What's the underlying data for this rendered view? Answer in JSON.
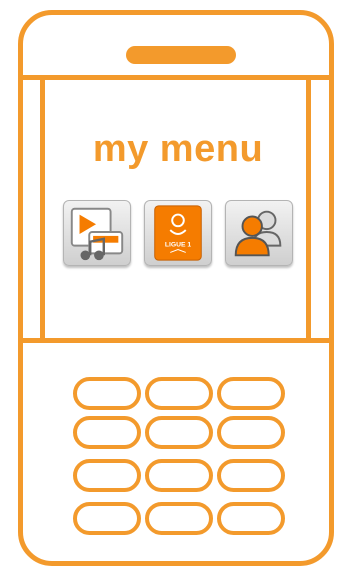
{
  "screen": {
    "title": "my menu"
  },
  "apps": [
    {
      "icon": "media-player-icon"
    },
    {
      "icon": "ligue-1-icon",
      "label": "LIGUE 1"
    },
    {
      "icon": "contacts-icon"
    }
  ],
  "colors": {
    "accent": "#f39a2c",
    "icon_orange": "#f57c00"
  }
}
